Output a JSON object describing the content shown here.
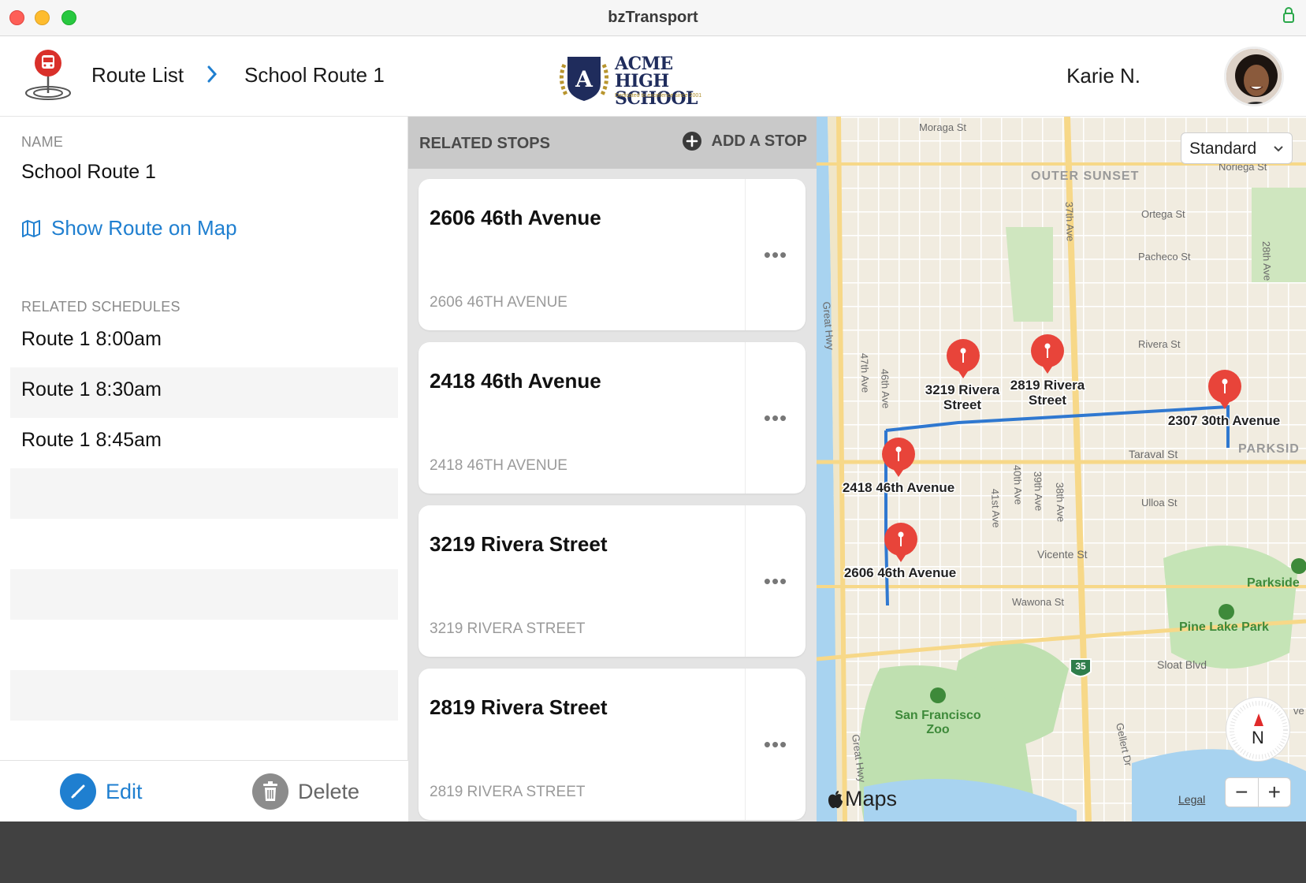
{
  "window": {
    "title": "bzTransport"
  },
  "breadcrumb": {
    "root": "Route List",
    "current": "School Route 1"
  },
  "school": {
    "name_line1": "ACME",
    "name_line2": "HIGH SCHOOL",
    "badge_letter": "A",
    "tagline": "Dedicated to excellence since 2001"
  },
  "user": {
    "name": "Karie N."
  },
  "details": {
    "name_label": "NAME",
    "route_name": "School Route 1",
    "show_map_label": "Show Route on Map",
    "schedules_label": "RELATED SCHEDULES",
    "schedules": [
      "Route 1 8:00am",
      "Route 1 8:30am",
      "Route 1 8:45am"
    ]
  },
  "footer": {
    "edit_label": "Edit",
    "delete_label": "Delete"
  },
  "stops": {
    "header": "RELATED STOPS",
    "add_label": "ADD A STOP",
    "more_glyph": "•••",
    "items": [
      {
        "title": "2606 46th Avenue",
        "address": "2606 46TH AVENUE"
      },
      {
        "title": "2418 46th Avenue",
        "address": "2418 46TH AVENUE"
      },
      {
        "title": "3219 Rivera Street",
        "address": "3219 RIVERA STREET"
      },
      {
        "title": "2819 Rivera Street",
        "address": "2819 RIVERA STREET"
      }
    ]
  },
  "map": {
    "style_option": "Standard",
    "compass_label": "N",
    "zoom_out": "−",
    "zoom_in": "+",
    "attribution": "Maps",
    "legal": "Legal",
    "route_color": "#2f78d0",
    "pin_color": "#e8443a",
    "pins": [
      {
        "label1": "3219 Rivera",
        "label2": "Street"
      },
      {
        "label1": "2819 Rivera",
        "label2": "Street"
      },
      {
        "label1": "2307 30th Avenue",
        "label2": ""
      },
      {
        "label1": "2418 46th Avenue",
        "label2": ""
      },
      {
        "label1": "2606 46th Avenue",
        "label2": ""
      }
    ],
    "streets": {
      "moraga": "Moraga St",
      "noriega": "Noriega St",
      "ortega": "Ortega St",
      "pacheco": "Pacheco St",
      "rivera": "Rivera St",
      "taraval": "Taraval St",
      "ulloa": "Ulloa St",
      "vicente": "Vicente St",
      "wawona": "Wawona St",
      "sloat": "Sloat Blvd",
      "great_hwy": "Great Hwy",
      "ave47": "47th Ave",
      "ave46": "46th Ave",
      "ave41": "41st Ave",
      "ave40": "40th Ave",
      "ave39": "39th Ave",
      "ave38": "38th Ave",
      "ave37": "37th Ave",
      "ave28": "28th Ave",
      "gellert": "Gellert Dr",
      "ave_partial": "ve"
    },
    "areas": {
      "outer_sunset": "OUTER SUNSET",
      "parkside": "PARKSID",
      "parkside_park": "Parkside",
      "pine_lake": "Pine Lake Park",
      "zoo1": "San Francisco",
      "zoo2": "Zoo",
      "highway": "35"
    }
  }
}
